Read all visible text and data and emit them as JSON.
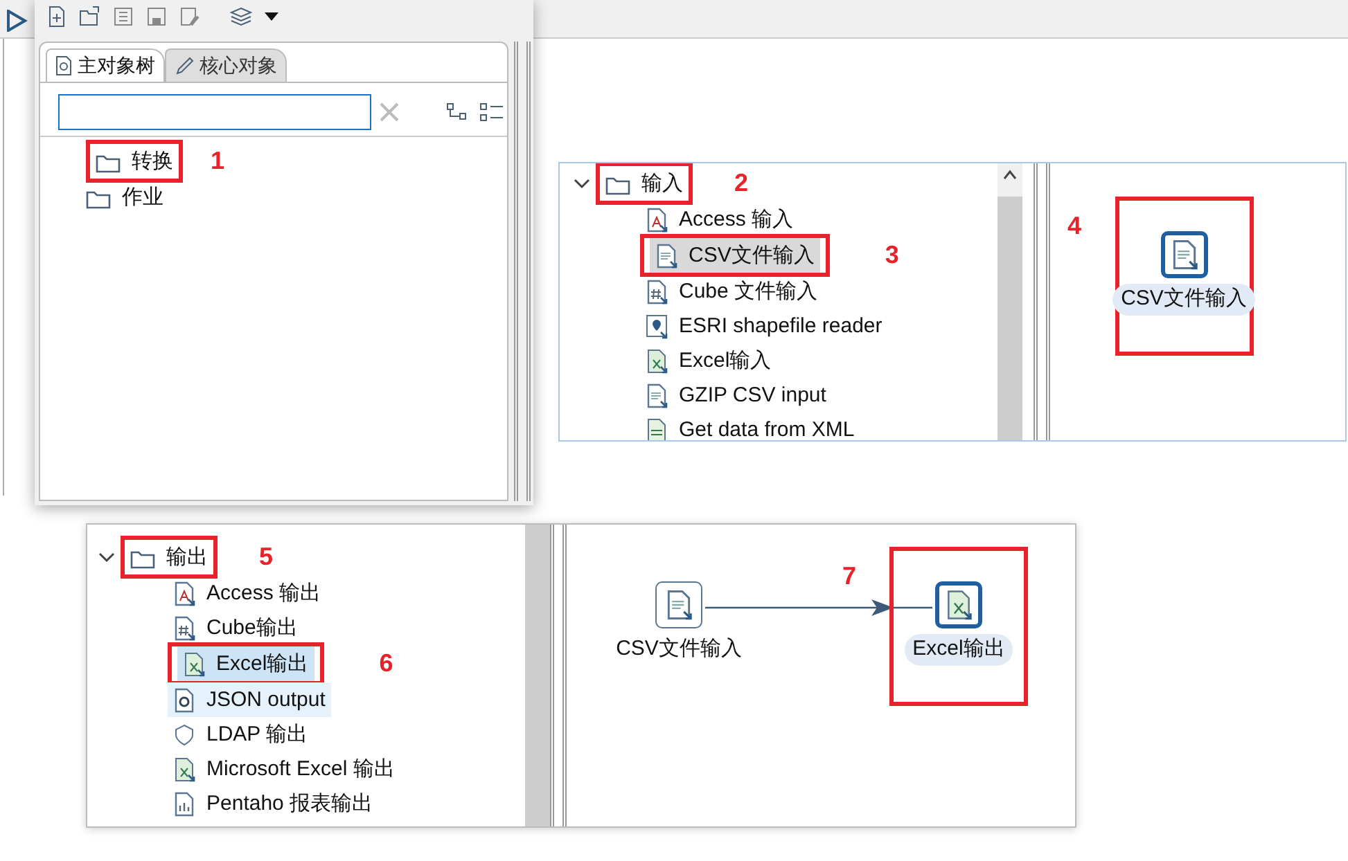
{
  "explorer_panel": {
    "tabs": [
      {
        "label": "主对象树",
        "kind": "tree",
        "selected": true
      },
      {
        "label": "核心对象",
        "kind": "pencil",
        "selected": false
      }
    ],
    "tree": [
      {
        "label": "转换",
        "callout": "1"
      },
      {
        "label": "作业"
      }
    ]
  },
  "input_panel": {
    "tree": [
      {
        "label": "输入",
        "expanded": true,
        "callout": "2",
        "children": [
          {
            "label": "Access 输入",
            "kind": "access",
            "selected": false
          },
          {
            "label": "CSV文件输入",
            "kind": "text",
            "selected": true,
            "callout": "3"
          },
          {
            "label": "Cube 文件输入",
            "kind": "cube",
            "selected": false
          },
          {
            "label": "ESRI shapefile reader",
            "kind": "map",
            "selected": false
          },
          {
            "label": "Excel输入",
            "kind": "excel",
            "selected": false
          },
          {
            "label": "GZIP CSV input",
            "kind": "text",
            "selected": false
          },
          {
            "label": "Get data from XML",
            "kind": "xml",
            "selected": false
          }
        ]
      }
    ],
    "canvas": {
      "nodes": [
        {
          "label": "CSV文件输入",
          "kind": "text",
          "selected": true,
          "callout": "4"
        }
      ]
    }
  },
  "output_panel": {
    "tree": [
      {
        "label": "输出",
        "expanded": true,
        "callout": "5",
        "children": [
          {
            "label": "Access 输出",
            "kind": "access",
            "selected": false,
            "hovered": false
          },
          {
            "label": "Cube输出",
            "kind": "cube",
            "selected": false,
            "hovered": false
          },
          {
            "label": "Excel输出",
            "kind": "excel",
            "selected": true,
            "hovered": false,
            "callout": "6"
          },
          {
            "label": "JSON output",
            "kind": "json",
            "selected": false,
            "hovered": true
          },
          {
            "label": "LDAP 输出",
            "kind": "shield",
            "selected": false,
            "hovered": false
          },
          {
            "label": "Microsoft Excel 输出",
            "kind": "excel",
            "selected": false,
            "hovered": false
          },
          {
            "label": "Pentaho 报表输出",
            "kind": "chart",
            "selected": false,
            "hovered": false
          }
        ]
      }
    ],
    "canvas": {
      "nodes": [
        {
          "label": "CSV文件输入",
          "kind": "text",
          "selected": false
        },
        {
          "label": "Excel输出",
          "kind": "excel",
          "selected": true,
          "callout": "7"
        }
      ]
    }
  }
}
